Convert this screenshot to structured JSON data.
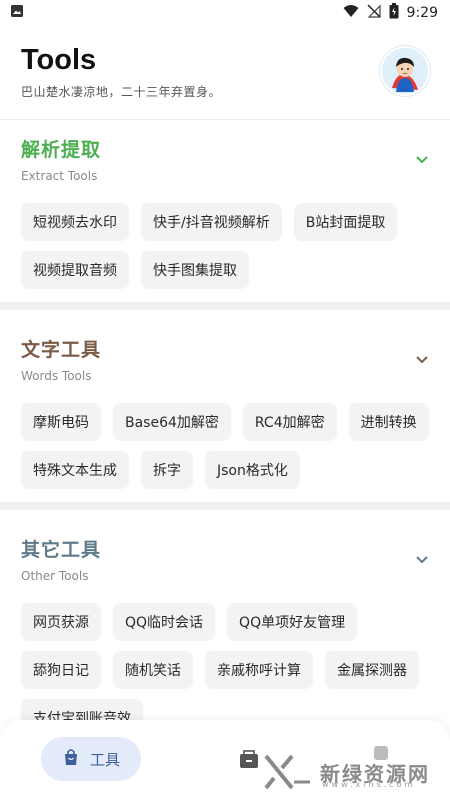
{
  "status_bar": {
    "time": "9:29",
    "icons": [
      "image-icon",
      "wifi-icon",
      "no-signal-icon",
      "battery-icon"
    ]
  },
  "header": {
    "title": "Tools",
    "subtitle": "巴山楚水凄凉地，二十三年弃置身。"
  },
  "sections": [
    {
      "title": "解析提取",
      "subtitle": "Extract Tools",
      "title_color": "#4caf50",
      "chips": [
        "短视频去水印",
        "快手/抖音视频解析",
        "B站封面提取",
        "视频提取音频",
        "快手图集提取"
      ]
    },
    {
      "title": "文字工具",
      "subtitle": "Words Tools",
      "title_color": "#7b5a47",
      "chips": [
        "摩斯电码",
        "Base64加解密",
        "RC4加解密",
        "进制转换",
        "特殊文本生成",
        "拆字",
        "Json格式化"
      ]
    },
    {
      "title": "其它工具",
      "subtitle": "Other Tools",
      "title_color": "#5f7a8a",
      "chips": [
        "网页获源",
        "QQ临时会话",
        "QQ单项好友管理",
        "舔狗日记",
        "随机笑话",
        "亲戚称呼计算",
        "金属探测器",
        "支付宝到账音效"
      ]
    }
  ],
  "bottom_nav": {
    "active_label": "工具",
    "active_color": "#e3ebfb"
  },
  "watermark": {
    "text": "新绿资源网",
    "url": "www.xlhs.com"
  }
}
